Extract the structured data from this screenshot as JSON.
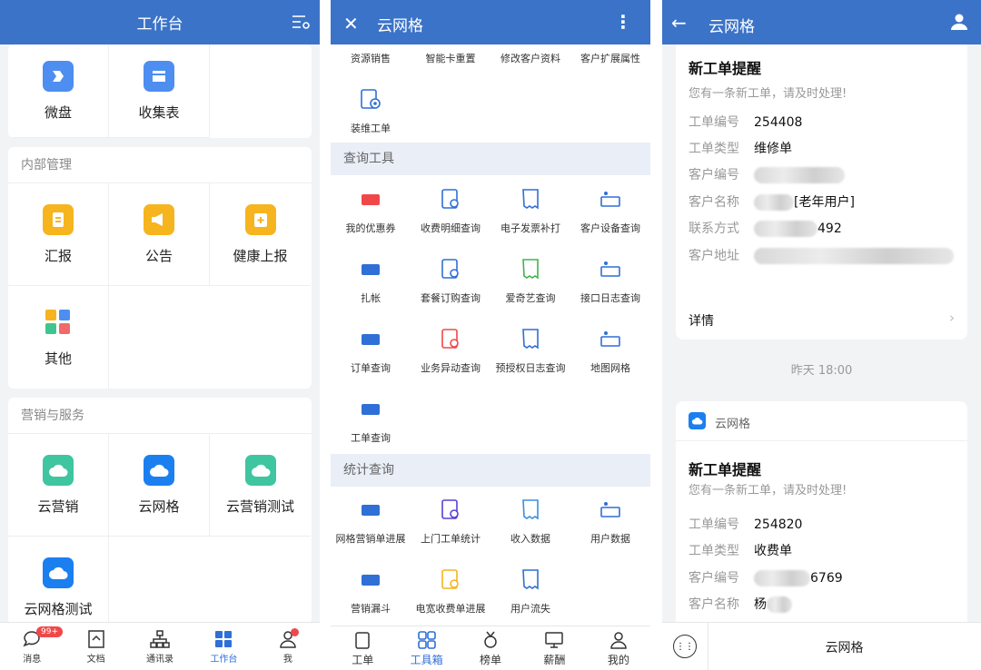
{
  "panel1": {
    "title": "工作台",
    "top_items": [
      {
        "label": "微盘"
      },
      {
        "label": "收集表"
      }
    ],
    "internal": {
      "section": "内部管理",
      "items": [
        {
          "label": "汇报"
        },
        {
          "label": "公告"
        },
        {
          "label": "健康上报"
        },
        {
          "label": "其他"
        }
      ]
    },
    "marketing": {
      "section": "营销与服务",
      "items": [
        {
          "label": "云营销"
        },
        {
          "label": "云网格"
        },
        {
          "label": "云营销测试"
        },
        {
          "label": "云网格测试"
        }
      ]
    },
    "tabs": [
      {
        "label": "消息",
        "badge": "99+"
      },
      {
        "label": "文档"
      },
      {
        "label": "通讯录"
      },
      {
        "label": "工作台"
      },
      {
        "label": "我"
      }
    ],
    "accent": "#3b73c8"
  },
  "panel2": {
    "title": "云网格",
    "top_row": [
      "资源销售",
      "智能卡重置",
      "修改客户资料",
      "客户扩展属性"
    ],
    "install_item": "装维工单",
    "query_section": "查询工具",
    "query_items": [
      "我的优惠券",
      "收费明细查询",
      "电子发票补打",
      "客户设备查询",
      "扎帐",
      "套餐订购查询",
      "爱奇艺查询",
      "接口日志查询",
      "订单查询",
      "业务异动查询",
      "预授权日志查询",
      "地图网格",
      "工单查询"
    ],
    "stats_section": "统计查询",
    "stats_items": [
      "网格营销单进展",
      "上门工单统计",
      "收入数据",
      "用户数据",
      "营销漏斗",
      "电宽收费单进展",
      "用户流失"
    ],
    "tabs": [
      "工单",
      "工具箱",
      "榜单",
      "薪酬",
      "我的"
    ]
  },
  "panel3": {
    "title": "云网格",
    "msg1": {
      "title": "新工单提醒",
      "subtitle": "您有一条新工单，请及时处理!",
      "order_no_label": "工单编号",
      "order_no": "254408",
      "type_label": "工单类型",
      "type": "维修单",
      "cust_no_label": "客户编号",
      "cust_name_label": "客户名称",
      "cust_name_suffix": "[老年用户]",
      "contact_label": "联系方式",
      "contact_suffix": "492",
      "address_label": "客户地址",
      "detail": "详情"
    },
    "time": "昨天  18:00",
    "msg2": {
      "app": "云网格",
      "title": "新工单提醒",
      "subtitle": "您有一条新工单，请及时处理!",
      "order_no_label": "工单编号",
      "order_no": "254820",
      "type_label": "工单类型",
      "type": "收费单",
      "cust_no_label": "客户编号",
      "cust_no_suffix": "6769",
      "cust_name_label": "客户名称",
      "cust_name_prefix": "杨"
    },
    "bottom": "云网格"
  }
}
